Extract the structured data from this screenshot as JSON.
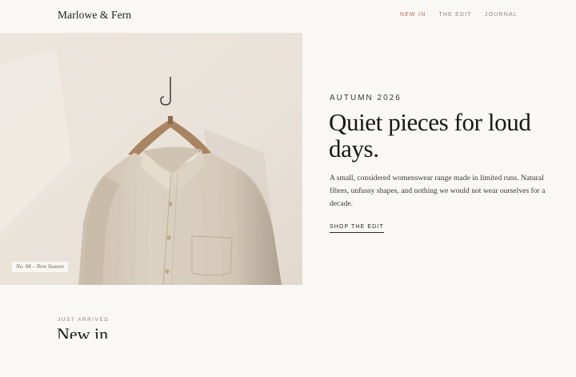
{
  "brand": {
    "name": "Marlowe & Fern"
  },
  "nav": {
    "items": [
      {
        "label": "NEW IN",
        "active": true
      },
      {
        "label": "THE EDIT",
        "active": false
      },
      {
        "label": "JOURNAL",
        "active": false
      }
    ]
  },
  "hero": {
    "image_caption": "No. 04 – New Season",
    "eyebrow": "AUTUMN 2026",
    "headline": "Quiet pieces for loud days.",
    "lede": "A small, considered womenswear range made in limited runs. Natural fibres, unfussy shapes, and nothing we would not wear ourselves for a decade.",
    "cta_label": "SHOP THE EDIT"
  },
  "section": {
    "eyebrow": "JUST ARRIVED",
    "title": "New in"
  },
  "colors": {
    "background": "#faf8f5",
    "accent": "#b4675d",
    "text": "#1f1d1b",
    "linen": "#d6ccbb"
  },
  "icons": {
    "hero_image": "linen-shirt-on-hanger-photo"
  }
}
